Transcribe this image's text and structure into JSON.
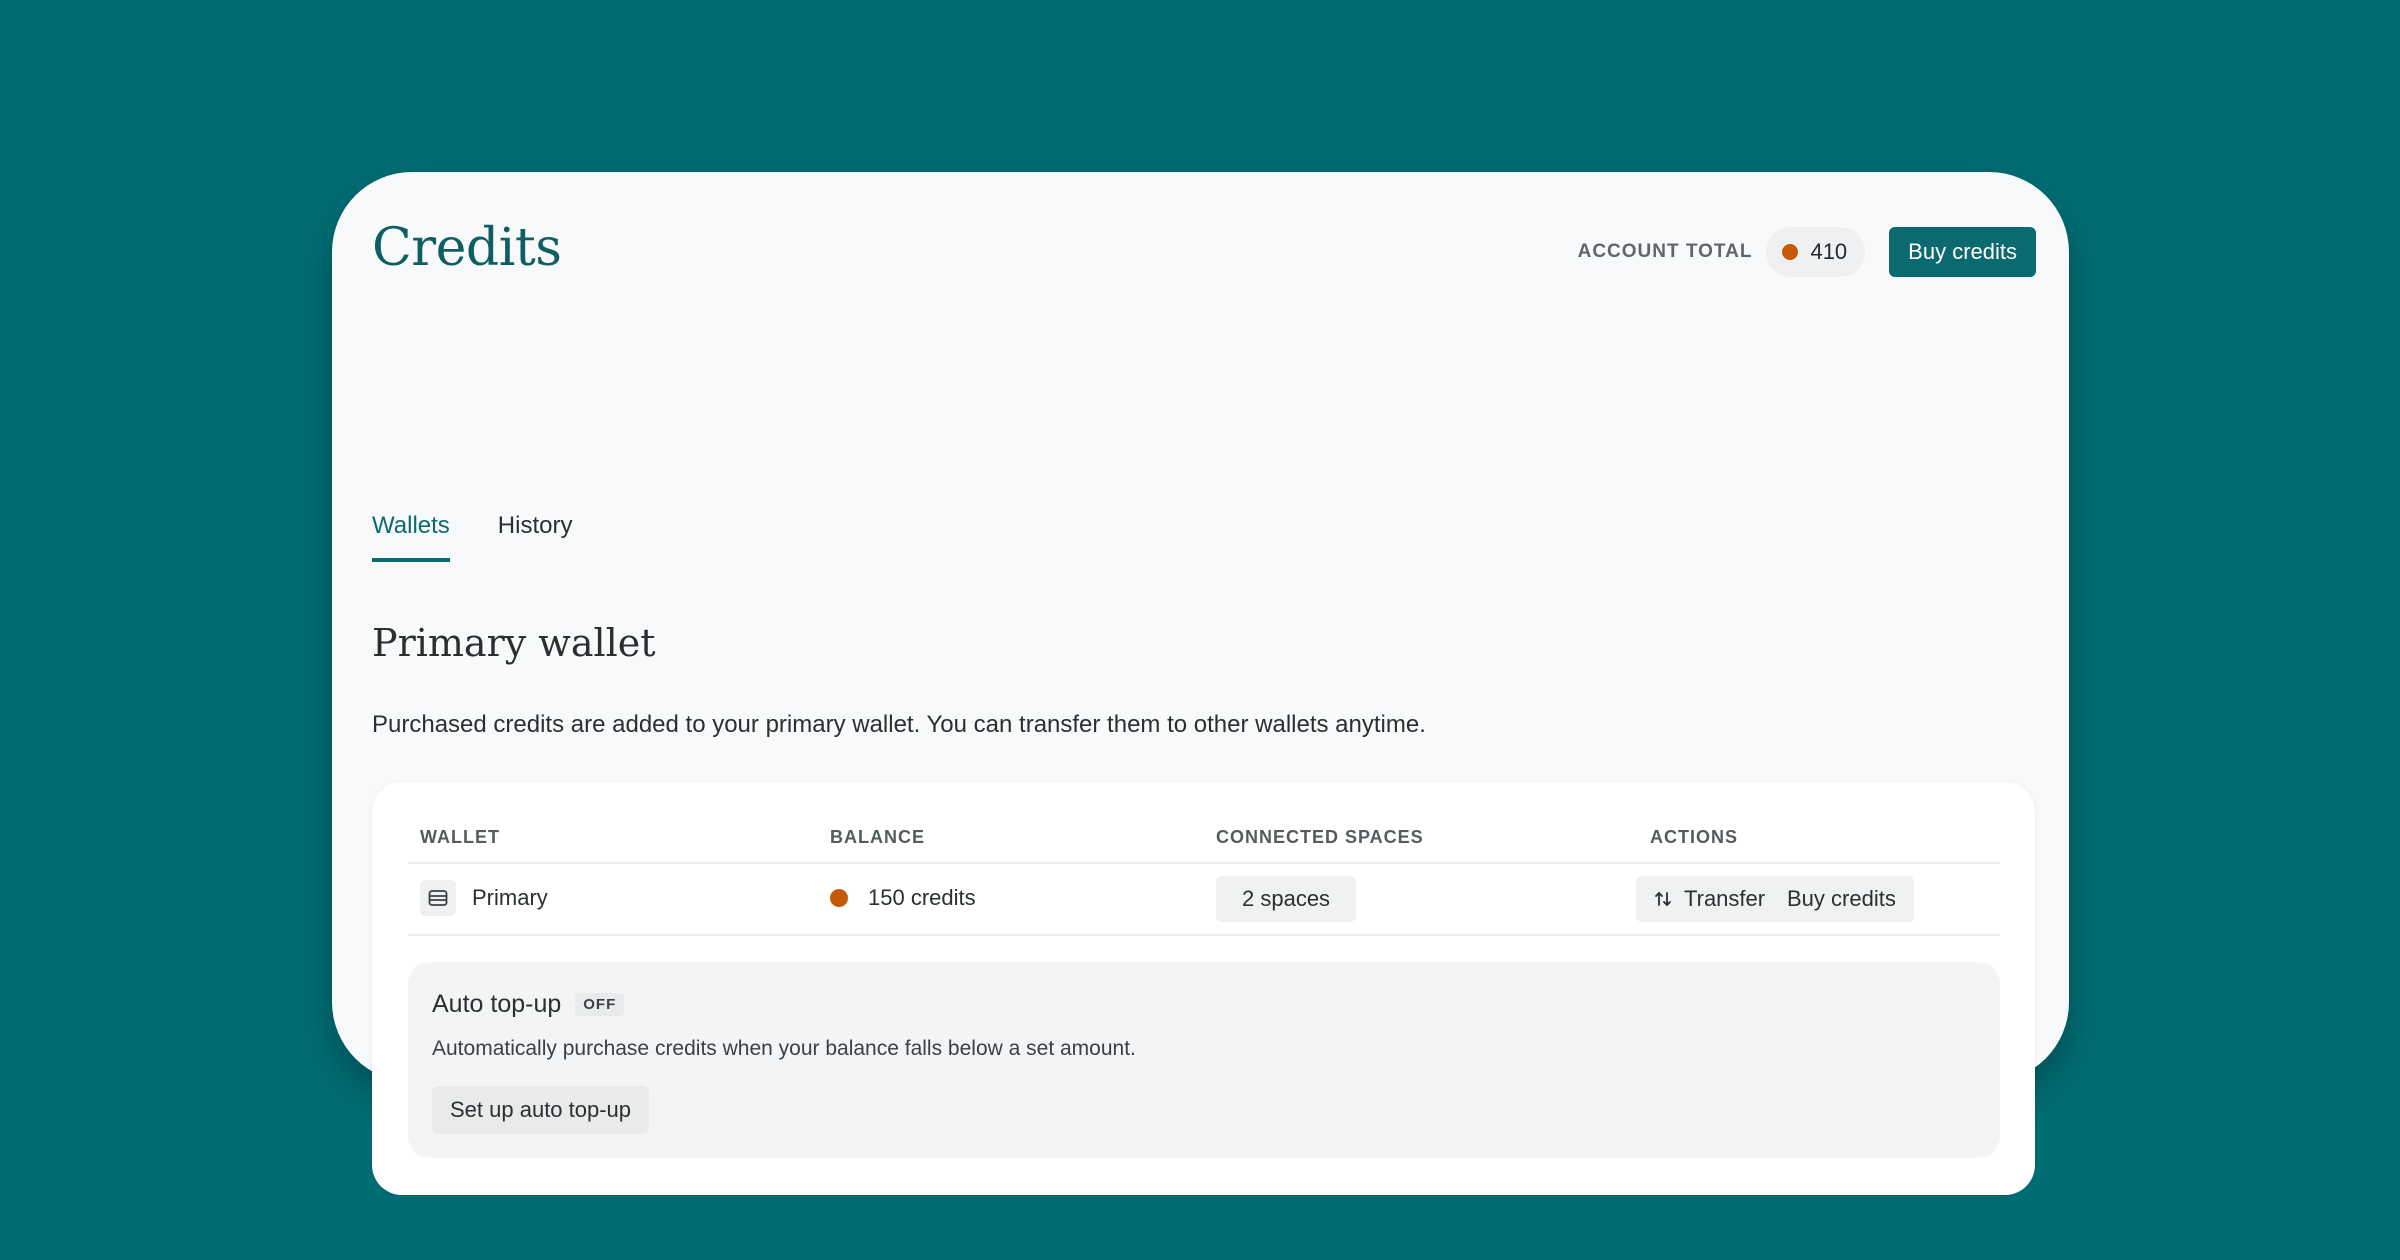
{
  "page": {
    "title": "Credits"
  },
  "header": {
    "account_total_label": "ACCOUNT TOTAL",
    "account_total_value": "410",
    "buy_credits_label": "Buy credits"
  },
  "tabs": [
    {
      "label": "Wallets",
      "active": true
    },
    {
      "label": "History",
      "active": false
    }
  ],
  "section": {
    "title": "Primary wallet",
    "description": "Purchased credits are added to your primary wallet. You can transfer them to other wallets anytime."
  },
  "table": {
    "columns": [
      "WALLET",
      "BALANCE",
      "CONNECTED SPACES",
      "ACTIONS"
    ],
    "rows": [
      {
        "wallet": "Primary",
        "wallet_icon": "wallet-icon",
        "balance": "150 credits",
        "connected_spaces": "2 spaces",
        "actions": {
          "transfer_label": "Transfer",
          "buy_label": "Buy credits"
        }
      }
    ]
  },
  "auto_topup": {
    "title": "Auto top-up",
    "status": "OFF",
    "description": "Automatically purchase credits when your balance falls below a set amount.",
    "button_label": "Set up auto top-up"
  },
  "colors": {
    "background": "#006d74",
    "accent": "#0b6a70",
    "coin": "#c55a06",
    "card": "#f8f9fb"
  }
}
